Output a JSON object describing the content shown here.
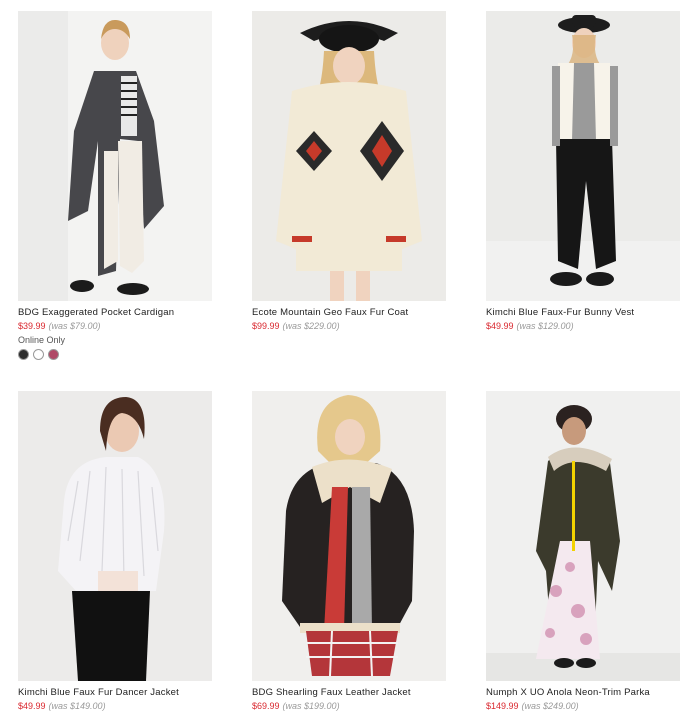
{
  "products": [
    {
      "name": "BDG Exaggerated Pocket Cardigan",
      "price": "$39.99",
      "was": "(was $79.00)",
      "online_only": "Online Only",
      "swatches": [
        "#2b2b2b",
        "#ffffff",
        "#b04a67"
      ]
    },
    {
      "name": "Ecote Mountain Geo Faux Fur Coat",
      "price": "$99.99",
      "was": "(was $229.00)"
    },
    {
      "name": "Kimchi Blue Faux-Fur Bunny Vest",
      "price": "$49.99",
      "was": "(was $129.00)"
    },
    {
      "name": "Kimchi Blue Faux Fur Dancer Jacket",
      "price": "$49.99",
      "was": "(was $149.00)"
    },
    {
      "name": "BDG Shearling Faux Leather Jacket",
      "price": "$69.99",
      "was": "(was $199.00)"
    },
    {
      "name": "Numph X UO Anola Neon-Trim Parka",
      "price": "$149.99",
      "was": "(was $249.00)"
    }
  ],
  "colors": {
    "sale_price": "#d9282f",
    "was_price": "#9a9a9a",
    "text": "#222222"
  }
}
